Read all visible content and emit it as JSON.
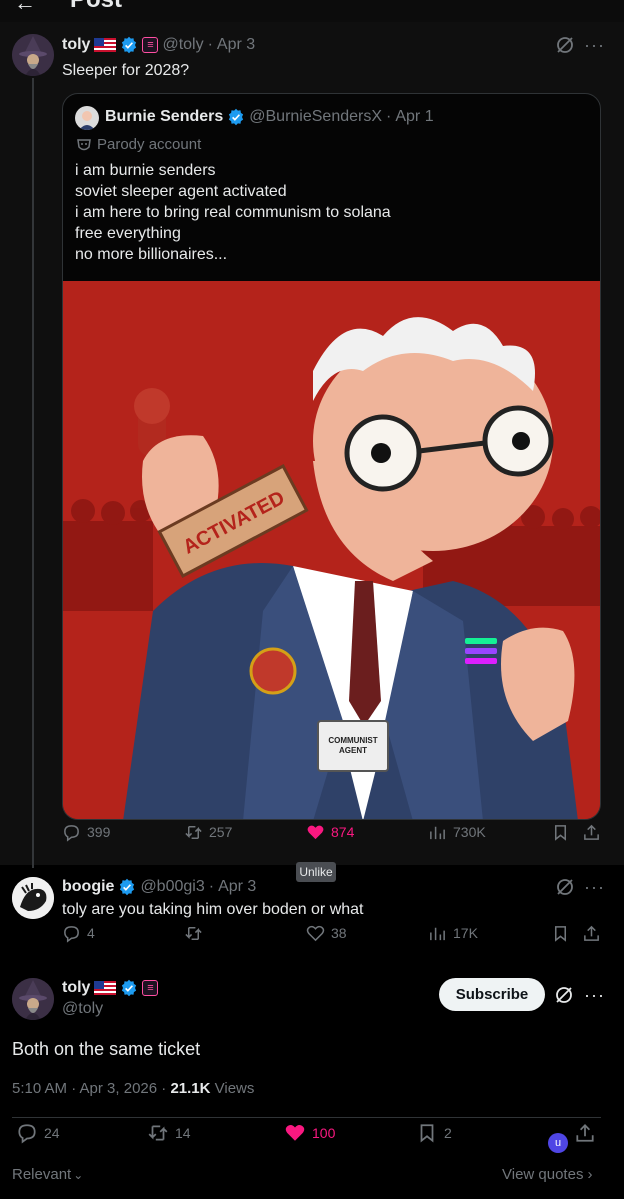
{
  "header": {
    "back_icon": "back-arrow-icon",
    "title": "Post"
  },
  "post1": {
    "display_name": "toly",
    "handle": "@toly",
    "dot": "·",
    "date": "Apr 3",
    "text": "Sleeper for 2028?",
    "quote": {
      "display_name": "Burnie Senders",
      "handle": "@BurnieSendersX",
      "dot": "·",
      "date": "Apr 1",
      "parody_label": "Parody account",
      "lines": [
        "i am burnie senders",
        "soviet sleeper agent activated",
        "i am here to bring real communism to solana",
        "free everything",
        "no more billionaires..."
      ],
      "image": {
        "stamp_text": "ACTIVATED",
        "badge_text_1": "COMMUNIST",
        "badge_text_2": "AGENT"
      }
    },
    "actions": {
      "replies": "399",
      "reposts": "257",
      "likes": "874",
      "views": "730K"
    },
    "tooltip": "Unlike"
  },
  "post2": {
    "display_name": "boogie",
    "handle": "@b00gi3",
    "dot": "·",
    "date": "Apr 3",
    "text": "toly are you taking him over boden or what",
    "actions": {
      "replies": "4",
      "reposts": "",
      "likes": "38",
      "views": "17K"
    }
  },
  "post3": {
    "display_name": "toly",
    "handle": "@toly",
    "subscribe_label": "Subscribe",
    "text": "Both on the same ticket",
    "timestamp": "5:10 AM · Apr 3, 2026 ·",
    "views_count": "21.1K",
    "views_label": "Views",
    "actions": {
      "replies": "24",
      "reposts": "14",
      "likes": "100",
      "bookmarks": "2"
    },
    "user_initial": "u"
  },
  "footer": {
    "sort_label": "Relevant",
    "view_quotes_label": "View quotes"
  },
  "colors": {
    "like_pink": "#f91880",
    "verified_blue": "#1d9bf0",
    "solana_pink": "#ff4fa2",
    "muted": "#71767b"
  }
}
